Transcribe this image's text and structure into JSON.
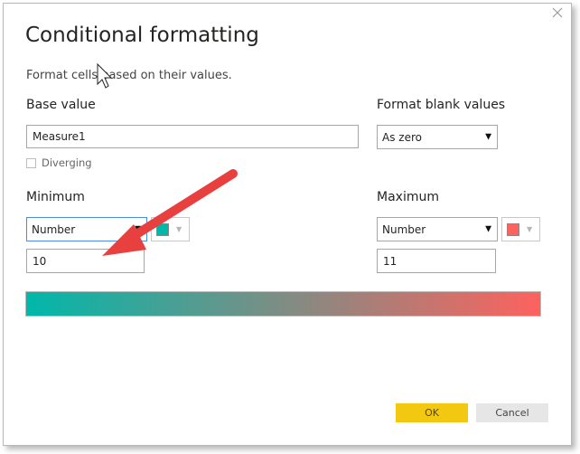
{
  "dialog": {
    "title": "Conditional formatting",
    "subtitle": "Format cells based on their values.",
    "close_icon": "close-icon"
  },
  "base_value": {
    "label": "Base value",
    "value": "Measure1"
  },
  "format_blank": {
    "label": "Format blank values",
    "selected": "As zero"
  },
  "diverging": {
    "label": "Diverging",
    "checked": false
  },
  "minimum": {
    "label": "Minimum",
    "type_selected": "Number",
    "value": "10",
    "color": "#00b8aa"
  },
  "maximum": {
    "label": "Maximum",
    "type_selected": "Number",
    "value": "11",
    "color": "#fd625e"
  },
  "buttons": {
    "ok": "OK",
    "cancel": "Cancel"
  },
  "colors": {
    "accent_ok": "#f2c811",
    "annotation_arrow": "#e8403f"
  }
}
